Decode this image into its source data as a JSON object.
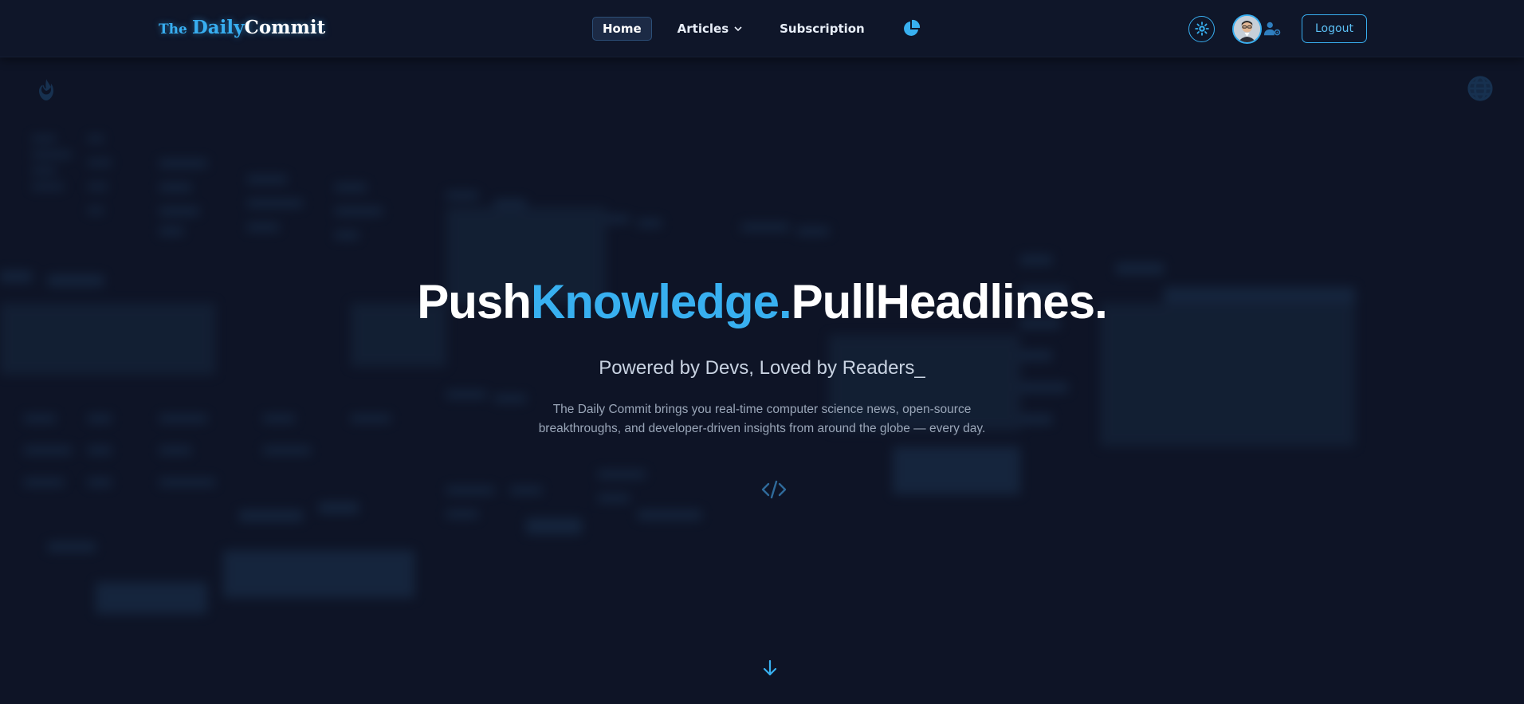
{
  "brand": {
    "the": "The",
    "daily": "Daily",
    "commit": "Commit"
  },
  "nav": {
    "home": "Home",
    "articles": "Articles",
    "subscription": "Subscription",
    "stats_icon": "pie-chart-icon"
  },
  "account": {
    "theme_icon": "sun-icon",
    "avatar_icon": "avatar",
    "profile_icon": "user-cog-icon",
    "logout": "Logout"
  },
  "hero": {
    "headline_push": "Push",
    "headline_knowledge": "Knowledge.",
    "headline_pull": "PullHeadlines.",
    "tagline": "Powered by Devs, Loved by Readers",
    "cursor": "_",
    "description": "The Daily Commit brings you real-time computer science news, open-source breakthroughs, and developer-driven insights from around the globe — every day.",
    "code_icon": "code-icon",
    "scroll_icon": "arrow-down-icon"
  },
  "decor": {
    "left_icon": "flame-icon",
    "right_icon": "globe-icon"
  },
  "colors": {
    "background": "#0e1426",
    "navbar": "#0f1629",
    "accent": "#38b0f0",
    "text": "#ffffff",
    "muted": "#9aa6b8"
  }
}
